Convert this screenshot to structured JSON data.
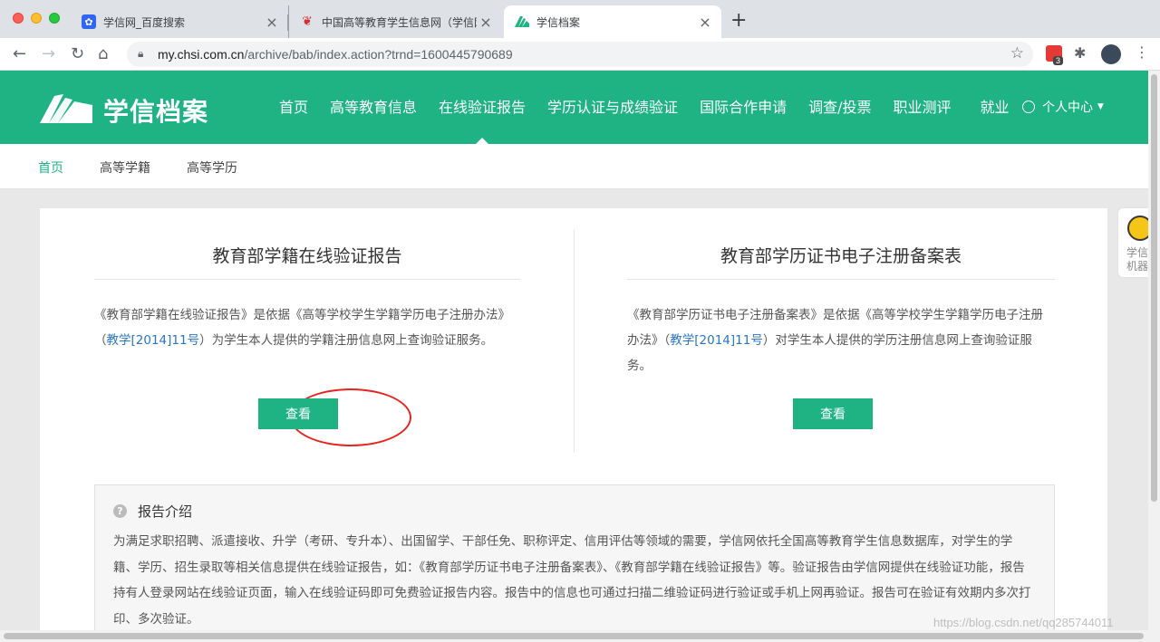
{
  "browser": {
    "tabs": [
      {
        "title": "学信网_百度搜索"
      },
      {
        "title": "中国高等教育学生信息网（学信网）"
      },
      {
        "title": "学信档案"
      }
    ],
    "url_host": "my.chsi.com.cn",
    "url_path": "/archive/bab/index.action?trnd=1600445790689",
    "ext_badge": "3"
  },
  "header": {
    "logo_text": "学信档案",
    "nav": [
      "首页",
      "高等教育信息",
      "在线验证报告",
      "学历认证与成绩验证",
      "国际合作申请",
      "调查/投票",
      "职业测评",
      "就业"
    ],
    "active_nav": "在线验证报告",
    "user_center": "个人中心"
  },
  "subnav": [
    "首页",
    "高等学籍",
    "高等学历"
  ],
  "left_card": {
    "title": "教育部学籍在线验证报告",
    "desc_pre": "《教育部学籍在线验证报告》是依据《高等学校学生学籍学历电子注册办法》（",
    "desc_link": "教学[2014]11号",
    "desc_post": "）为学生本人提供的学籍注册信息网上查询验证服务。",
    "button": "查看"
  },
  "right_card": {
    "title": "教育部学历证书电子注册备案表",
    "desc_pre": "《教育部学历证书电子注册备案表》是依据《高等学校学生学籍学历电子注册办法》（",
    "desc_link": "教学[2014]11号",
    "desc_post": "）对学生本人提供的学历注册信息网上查询验证服务。",
    "button": "查看"
  },
  "intro": {
    "heading": "报告介绍",
    "body": "为满足求职招聘、派遣接收、升学（考研、专升本）、出国留学、干部任免、职称评定、信用评估等领域的需要，学信网依托全国高等教育学生信息数据库，对学生的学籍、学历、招生录取等相关信息提供在线验证报告，如：《教育部学历证书电子注册备案表》、《教育部学籍在线验证报告》等。验证报告由学信网提供在线验证功能，报告持有人登录网站在线验证页面，输入在线验证码即可免费验证报告内容。报告中的信息也可通过扫描二维验证码进行验证或手机上网再验证。报告可在验证有效期内多次打印、多次验证。"
  },
  "side_widget": {
    "line1": "学信",
    "line2": "机器"
  },
  "watermark": "https://blog.csdn.net/qq285744011",
  "colors": {
    "brand": "#1fb383",
    "link": "#2a76c3",
    "annotation": "#e5251f"
  }
}
